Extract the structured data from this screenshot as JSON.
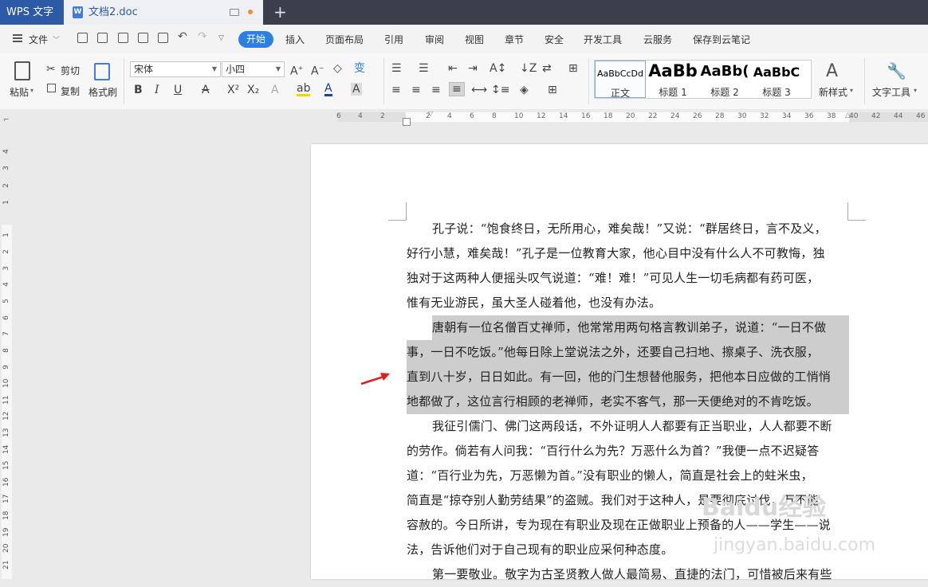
{
  "titlebar": {
    "app_name": "WPS 文字",
    "doc_tab": "文档2.doc",
    "new_tab": "+"
  },
  "menu": {
    "file": "文件",
    "items": [
      "开始",
      "插入",
      "页面布局",
      "引用",
      "审阅",
      "视图",
      "章节",
      "安全",
      "开发工具",
      "云服务",
      "保存到云笔记"
    ]
  },
  "ribbon": {
    "paste": "粘贴",
    "cut": "剪切",
    "copy": "复制",
    "format_painter": "格式刷",
    "font_name": "宋体",
    "font_size": "小四",
    "styles": [
      {
        "sample": "AaBbCcDd",
        "name": "正文"
      },
      {
        "sample": "AaBb",
        "name": "标题 1"
      },
      {
        "sample": "AaBb(",
        "name": "标题 2"
      },
      {
        "sample": "AaBbC",
        "name": "标题 3"
      }
    ],
    "new_style": "新样式",
    "text_tools": "文字工具"
  },
  "ruler": {
    "h_ticks": [
      "6",
      "4",
      "2",
      "2",
      "4",
      "6",
      "8",
      "10",
      "12",
      "14",
      "16",
      "18",
      "20",
      "22",
      "24",
      "26",
      "28",
      "30",
      "32",
      "34",
      "36",
      "38",
      "40",
      "42",
      "44",
      "46"
    ],
    "v_ticks": [
      "4",
      "3",
      "2",
      "1",
      "1",
      "2",
      "3",
      "4",
      "5",
      "6",
      "7",
      "8",
      "9",
      "10",
      "11",
      "12",
      "13",
      "14",
      "15",
      "16",
      "17",
      "18",
      "19",
      "20",
      "21"
    ]
  },
  "document": {
    "lines": [
      {
        "text": "孔子说：“饱食终日，无所用心，难矣哉！”又说：“群居终日，言不及义，",
        "indent": true,
        "selected": false
      },
      {
        "text": "好行小慧，难矣哉！”孔子是一位教育大家，他心目中没有什么人不可教悔，独",
        "indent": false,
        "selected": false
      },
      {
        "text": "独对于这两种人便摇头叹气说道：“难！难！”可见人生一切毛病都有药可医，",
        "indent": false,
        "selected": false
      },
      {
        "text": "惟有无业游民，虽大圣人碰着他，也没有办法。",
        "indent": false,
        "selected": false
      },
      {
        "text": "唐朝有一位名僧百丈禅师，他常常用两句格言教训弟子，说道：“一日不做",
        "indent": true,
        "selected": true
      },
      {
        "text": "事，一日不吃饭。”他每日除上堂说法之外，还要自己扫地、擦桌子、洗衣服，",
        "indent": false,
        "selected": true
      },
      {
        "text": "直到八十岁，日日如此。有一回，他的门生想替他服务，把他本日应做的工悄悄",
        "indent": false,
        "selected": true
      },
      {
        "text": "地都做了，这位言行相顾的老禅师，老实不客气，那一天便绝对的不肯吃饭。",
        "indent": false,
        "selected": true
      },
      {
        "text": "我征引儒门、佛门这两段话，不外证明人人都要有正当职业，人人都要不断",
        "indent": true,
        "selected": false
      },
      {
        "text": "的劳作。倘若有人问我：“百行什么为先？万恶什么为首？”我便一点不迟疑答",
        "indent": false,
        "selected": false
      },
      {
        "text": "道：“百行业为先，万恶懒为首。”没有职业的懒人，简直是社会上的蛀米虫，",
        "indent": false,
        "selected": false
      },
      {
        "text": "简直是“掠夺别人勤劳结果”的盗贼。我们对于这种人，是要彻底讨伐，万不能",
        "indent": false,
        "selected": false
      },
      {
        "text": "容赦的。今日所讲，专为现在有职业及现在正做职业上预备的人——学生——说",
        "indent": false,
        "selected": false
      },
      {
        "text": "法，告诉他们对于自己现有的职业应采何种态度。",
        "indent": false,
        "selected": false
      },
      {
        "text": "第一要敬业。敬字为古圣贤教人做人最简易、直捷的法门，可惜被后来有些",
        "indent": true,
        "selected": false
      }
    ]
  },
  "watermark": {
    "line1": "Baidu经验",
    "line2": "jingyan.baidu.com"
  },
  "colors": {
    "accent": "#2e7fe3",
    "titlebar": "#3a3f4b",
    "app_tab": "#2d5aa6",
    "selection": "#cdcdcd",
    "arrow": "#e02020"
  }
}
